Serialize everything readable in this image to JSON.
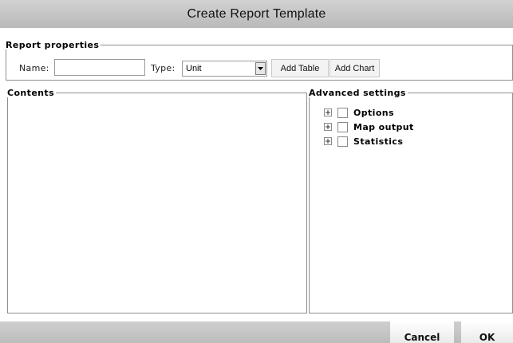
{
  "window": {
    "title": "Create Report Template"
  },
  "report_properties": {
    "legend": "Report properties",
    "name_label": "Name:",
    "name_value": "",
    "type_label": "Type:",
    "type_selected": "Unit",
    "add_table_label": "Add Table",
    "add_chart_label": "Add Chart"
  },
  "contents": {
    "legend": "Contents"
  },
  "advanced_settings": {
    "legend": "Advanced settings",
    "items": [
      {
        "label": "Options",
        "checked": false,
        "expanded": false
      },
      {
        "label": "Map output",
        "checked": false,
        "expanded": false
      },
      {
        "label": "Statistics",
        "checked": false,
        "expanded": false
      }
    ]
  },
  "footer": {
    "cancel_label": "Cancel",
    "ok_label": "OK"
  },
  "icons": {
    "expander": "plus-square-icon",
    "dropdown": "dropdown-arrow-icon"
  }
}
